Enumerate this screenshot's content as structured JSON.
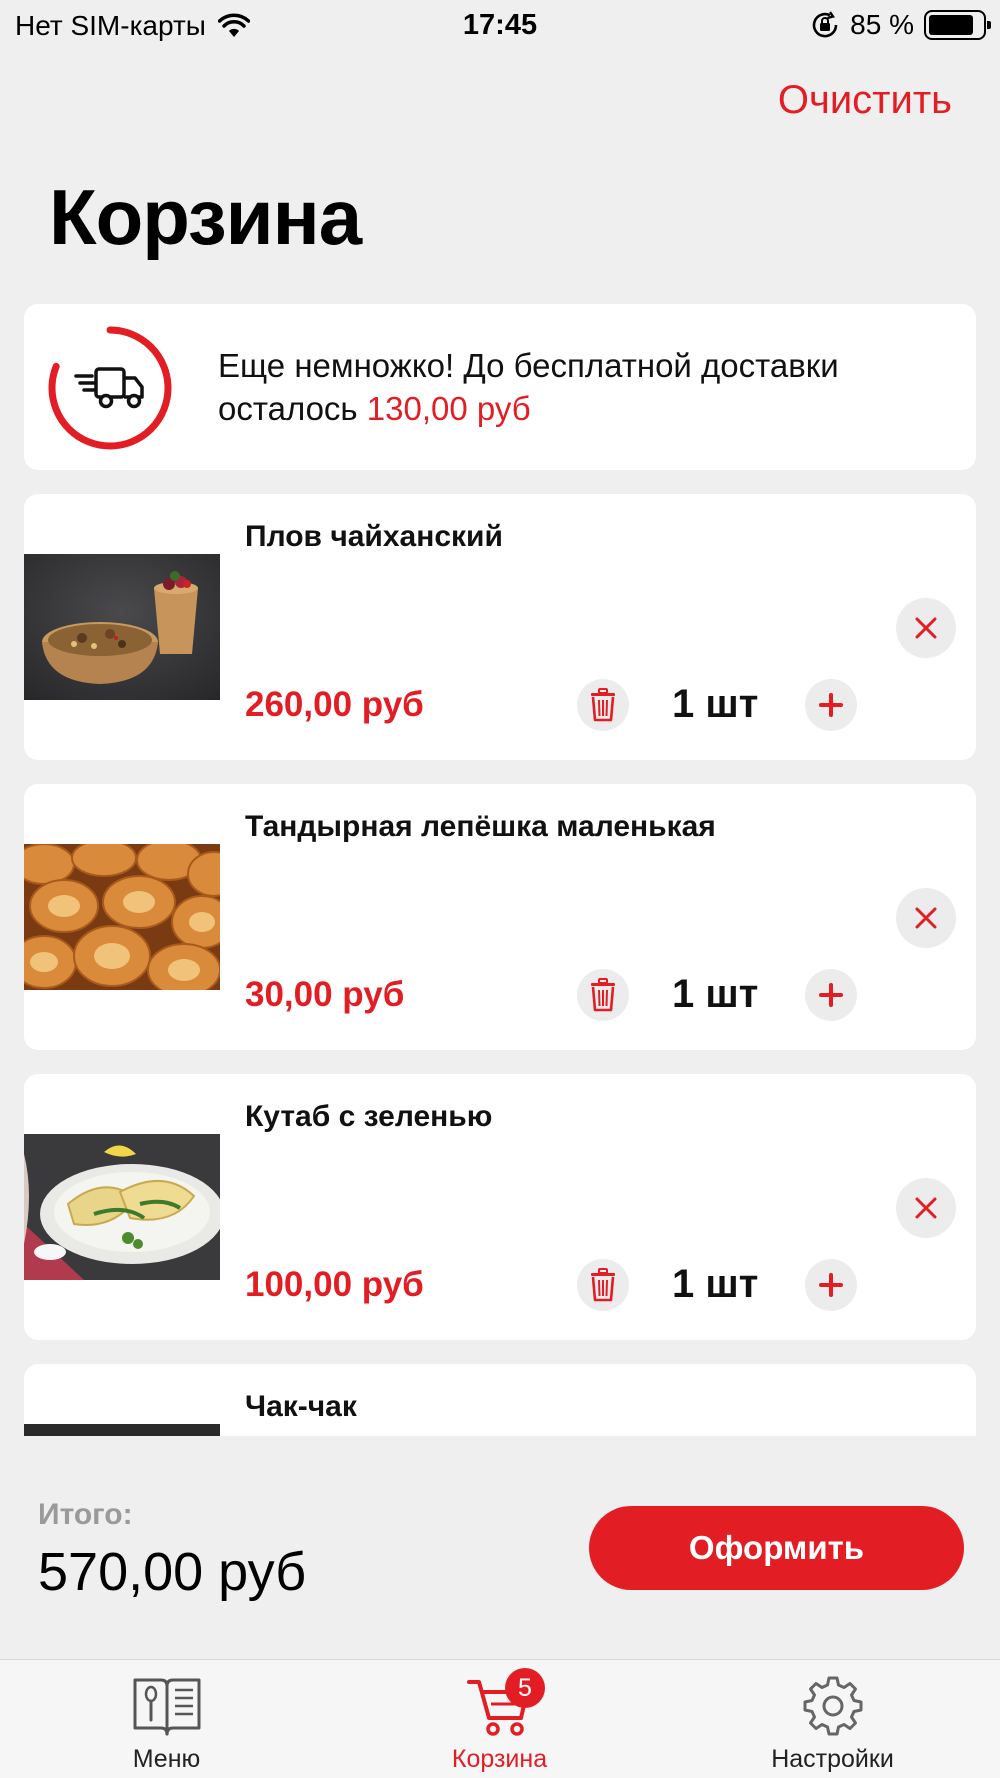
{
  "status_bar": {
    "carrier": "Нет SIM-карты",
    "time": "17:45",
    "battery_text": "85 %",
    "battery_level": 0.85
  },
  "header": {
    "clear_label": "Очистить",
    "title": "Корзина"
  },
  "delivery_banner": {
    "text_line1": "Еще немножко! До бесплатной доставки",
    "text_line2_prefix": "осталось",
    "remaining": "130,00 руб",
    "progress": 0.81,
    "icon": "delivery-truck-icon"
  },
  "cart": {
    "items": [
      {
        "name": "Плов чайханский",
        "price": "260,00 руб",
        "qty": "1 шт"
      },
      {
        "name": "Тандырная лепёшка маленькая",
        "price": "30,00 руб",
        "qty": "1 шт"
      },
      {
        "name": "Кутаб с зеленью",
        "price": "100,00 руб",
        "qty": "1 шт"
      },
      {
        "name": "Чак-чак",
        "price": "",
        "qty": ""
      }
    ]
  },
  "summary": {
    "total_label": "Итого:",
    "total_value": "570,00 руб",
    "checkout_label": "Оформить"
  },
  "tab_bar": {
    "tabs": [
      {
        "label": "Меню",
        "icon": "menu-book-icon"
      },
      {
        "label": "Корзина",
        "icon": "cart-icon",
        "badge": "5"
      },
      {
        "label": "Настройки",
        "icon": "gear-icon"
      }
    ]
  },
  "colors": {
    "accent": "#e31d24",
    "background": "#efefef",
    "card": "#ffffff"
  }
}
